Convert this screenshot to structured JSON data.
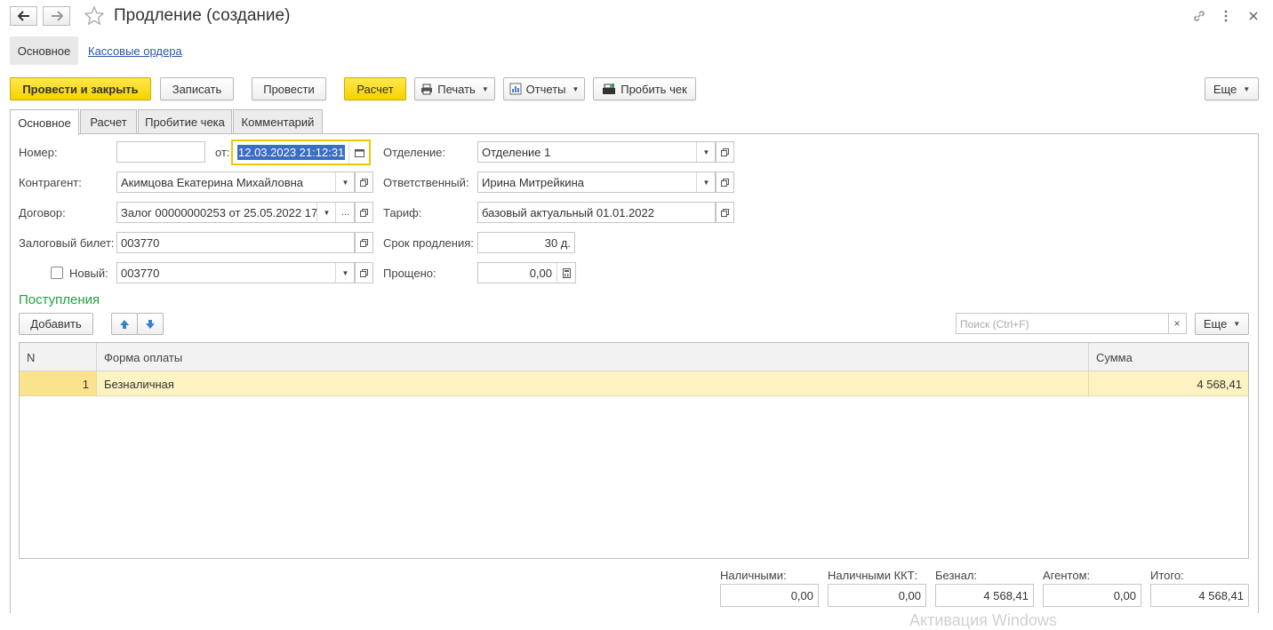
{
  "window": {
    "title": "Продление (создание)",
    "icons": [
      "back-arrow-icon",
      "forward-arrow-icon",
      "star-icon",
      "link-icon",
      "more-vertical-icon",
      "close-icon"
    ]
  },
  "sections": {
    "main": "Основное",
    "cash_orders_link": "Кассовые ордера"
  },
  "toolbar": {
    "post_and_close": "Провести и закрыть",
    "save": "Записать",
    "post": "Провести",
    "calc": "Расчет",
    "print": "Печать",
    "reports": "Отчеты",
    "punch_receipt": "Пробить чек",
    "more": "Еще"
  },
  "tabs": [
    "Основное",
    "Расчет",
    "Пробитие чека",
    "Комментарий"
  ],
  "form": {
    "number_label": "Номер:",
    "number_value": "",
    "from_label": "от:",
    "date_value": "12.03.2023 21:12:31",
    "counterparty_label": "Контрагент:",
    "counterparty_value": "Акимцова Екатерина Михайловна",
    "contract_label": "Договор:",
    "contract_value": "Залог 00000000253 от 25.05.2022 17:",
    "contract_ellipsis": "...",
    "pledge_ticket_label": "Залоговый билет:",
    "pledge_ticket_value": "003770",
    "new_label": "Новый:",
    "new_value": "003770",
    "department_label": "Отделение:",
    "department_value": "Отделение 1",
    "responsible_label": "Ответственный:",
    "responsible_value": "Ирина Митрейкина",
    "tariff_label": "Тариф:",
    "tariff_value": "базовый актуальный 01.01.2022",
    "extension_label": "Срок продления:",
    "extension_value": "30 д.",
    "forgiven_label": "Прощено:",
    "forgiven_value": "0,00"
  },
  "receipts": {
    "title": "Поступления",
    "add": "Добавить",
    "search_placeholder": "Поиск (Ctrl+F)",
    "search_clear": "×",
    "more": "Еще",
    "columns": [
      "N",
      "Форма оплаты",
      "Сумма"
    ],
    "rows": [
      {
        "n": "1",
        "form": "Безналичная",
        "sum": "4 568,41"
      }
    ]
  },
  "totals": {
    "cash_label": "Наличными:",
    "cash_value": "0,00",
    "cash_kkt_label": "Наличными ККТ:",
    "cash_kkt_value": "0,00",
    "noncash_label": "Безнал:",
    "noncash_value": "4 568,41",
    "agent_label": "Агентом:",
    "agent_value": "0,00",
    "total_label": "Итого:",
    "total_value": "4 568,41"
  },
  "watermark": "Активация Windows",
  "colors": {
    "accent_yellow": "#f5d200",
    "link_blue": "#2a56a8",
    "section_green": "#21a041",
    "row_highlight": "#fdf3c2"
  }
}
